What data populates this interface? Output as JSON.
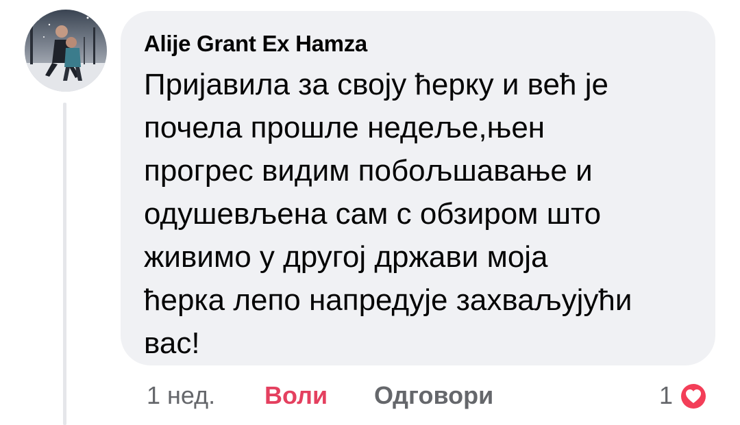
{
  "comment": {
    "author": "Alije Grant Ex Hamza",
    "text": "Пријавила за своју ћерку и већ је\nпочела прошле недеље,њен\nпрогрес видим побољшавање и\nодушевљена сам с обзиром што\nживимо у другој држави моја\nћерка лепо напредује захваљујући\nвас!",
    "avatar_icon": "profile-photo"
  },
  "actions": {
    "time": "1 нед.",
    "like_label": "Воли",
    "reply_label": "Одговори",
    "reaction_count": "1",
    "reaction_icon": "heart-icon"
  },
  "colors": {
    "bubble": "#f0f1f4",
    "like_active": "#e4405f",
    "secondary_text": "#65676b",
    "heart": "#f33e58"
  }
}
